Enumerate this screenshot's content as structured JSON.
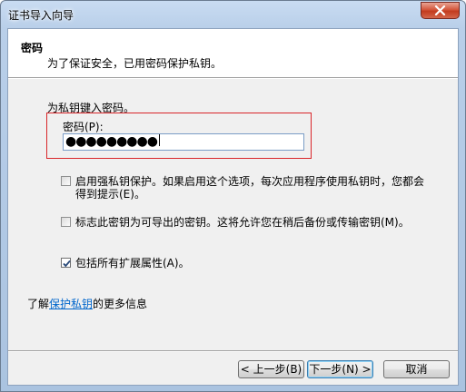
{
  "window": {
    "title": "证书导入向导"
  },
  "header": {
    "title": "密码",
    "subtitle": "为了保证安全，已用密码保护私钥。"
  },
  "form": {
    "prompt": "为私钥键入密码。",
    "password_label": "密码(P):",
    "password_mask": "●●●●●●●●●"
  },
  "options": [
    {
      "label_line1": "启用强私钥保护。如果启用这个选项，每次应用程序使用私钥时，您都会",
      "label_line2": "得到提示(E)。",
      "checked": false
    },
    {
      "label_line1": "标志此密钥为可导出的密钥。这将允许您在稍后备份或传输密钥(M)。",
      "checked": false
    },
    {
      "label_line1": "包括所有扩展属性(A)。",
      "checked": true
    }
  ],
  "learn_more": {
    "prefix": "了解",
    "link": "保护私钥",
    "suffix": "的更多信息"
  },
  "buttons": {
    "back": "< 上一步(B)",
    "next": "下一步(N) >",
    "cancel": "取消"
  },
  "colors": {
    "highlight_border": "#d9262a",
    "link": "#0066cc"
  }
}
